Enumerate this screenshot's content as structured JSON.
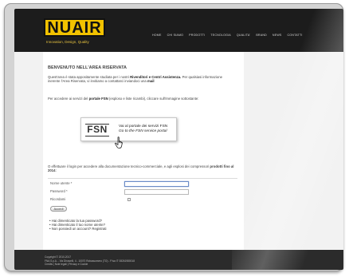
{
  "brand": {
    "logo_text": "NUAIR",
    "tagline": "Innovation, Design, Quality",
    "colors": {
      "logo": "#f2c200",
      "header": "#1c1c1c",
      "footer": "#2b2b2b"
    }
  },
  "nav": [
    "HOME",
    "CHI SIAMO",
    "PRODOTTI",
    "TECNOLOGIA",
    "QUALITA'",
    "BRAND",
    "NEWS",
    "CONTATTI"
  ],
  "main": {
    "heading": "BENVENUTO NELL'AREA RISERVATA",
    "intro_1": "Quest'area è stata appositamente studiata per i nostri ",
    "intro_1_bold": "Rivenditori e Centri Assistenza.",
    "intro_2": "Per qualsiasi informazione inerente l'Area Riservata, vi invitiamo a contattarci inviandoci una ",
    "intro_2_bold": "mail",
    "fsn_intro_a": "Per accedere ai servizi del ",
    "fsn_intro_bold": "portale FSN",
    "fsn_intro_b": " (esploso e liste ricambi), cliccare sull'immagine sottostante:",
    "fsn": {
      "logo": "FSN",
      "line1": "Vai al portale dei servizi FSN",
      "line2": "Go to the FSN service portal"
    },
    "login_intro_a": "O effettuare il login per accedere alla documentazione tecnico-commerciale, e agli esplosi dei compressori ",
    "login_intro_bold": "prodotti fino al 2014",
    "login_intro_b": ":",
    "form": {
      "username_label": "Nome utente *",
      "password_label": "Password *",
      "remember_label": "Ricordami",
      "submit_label": "Accedi"
    },
    "links": [
      "Hai dimenticato la tua password?",
      "Hai dimenticato il tuo nome utente?",
      "Non possiedi un account? Registrati"
    ]
  },
  "footer": {
    "copyright": "Copyright © 2010-2017",
    "company": "FNA S.p.A. - Via Dinavelli, 4 - 10070 Robassomero (TO) - P.iva IT 08261980018",
    "links": "Credits | Note legali | Privacy e Cookie"
  }
}
